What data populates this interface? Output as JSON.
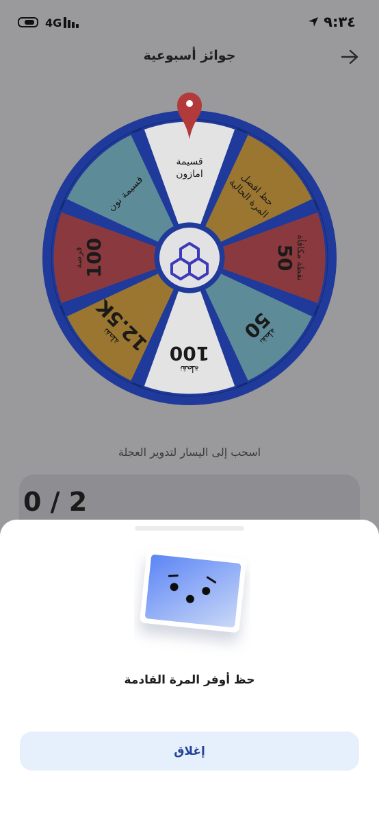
{
  "status_bar": {
    "network": "4G",
    "time": "٩:٣٤"
  },
  "header": {
    "title": "جوائز أسبوعية"
  },
  "wheel": {
    "segments": [
      {
        "line1": "قسيمة",
        "line2": "امازون",
        "color": "#e3e3e3"
      },
      {
        "line1": "حظ افضل",
        "line2": "المرة الحالية",
        "color": "#9a7630"
      },
      {
        "line1": "50",
        "line2": "نقطة مكافأة",
        "color": "#8a3a3e"
      },
      {
        "line1": "50",
        "line2": "نقطة",
        "color": "#5e8b98"
      },
      {
        "line1": "100",
        "line2": "نقطة",
        "color": "#e3e3e3"
      },
      {
        "line1": "12.5K",
        "line2": "نقطة",
        "color": "#9a7630"
      },
      {
        "line1": "100",
        "line2": "فرصة",
        "color": "#8a3a3e"
      },
      {
        "line1": "قسيمة نون",
        "line2": "",
        "color": "#5e8b98"
      }
    ],
    "rim_color": "#1f3a9a",
    "pointer_color": "#b33a3a"
  },
  "instructions": {
    "hint": "اسحب إلى اليسار لتدوير العجلة"
  },
  "progress": {
    "value": "0 / 2"
  },
  "result_sheet": {
    "message": "حظ أوفر المرة القادمة",
    "close_label": "إغلاق"
  }
}
